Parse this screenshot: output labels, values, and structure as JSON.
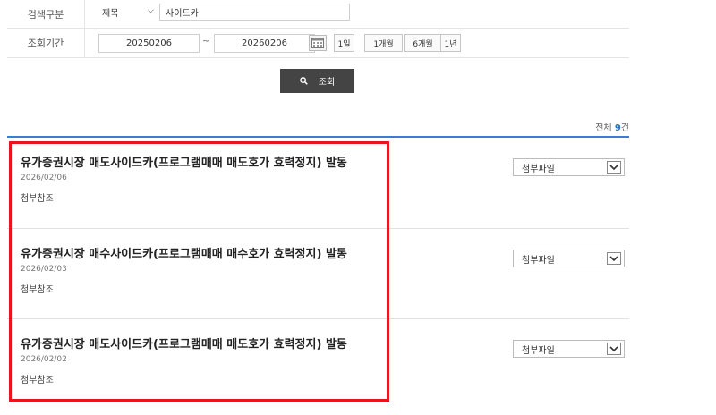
{
  "search_form": {
    "search_type_label": "검색구분",
    "search_field_selected": "제목",
    "search_keyword": "사이드카",
    "period_label": "조회기간",
    "date_from": "20250206",
    "date_separator": "~",
    "date_to": "20260206",
    "period_buttons": [
      "1일",
      "1개월",
      "6개월",
      "1년"
    ],
    "search_button_label": "조회"
  },
  "results": {
    "total_prefix": "전체 ",
    "total_count": "9",
    "total_suffix": "건",
    "items": [
      {
        "title": "유가증권시장 매도사이드카(프로그램매매 매도호가 효력정지) 발동",
        "date": "2026/02/06",
        "note": "첨부참조",
        "attachment_label": "첨부파일"
      },
      {
        "title": "유가증권시장 매수사이드카(프로그램매매 매수호가 효력정지) 발동",
        "date": "2026/02/03",
        "note": "첨부참조",
        "attachment_label": "첨부파일"
      },
      {
        "title": "유가증권시장 매도사이드카(프로그램매매 매도호가 효력정지) 발동",
        "date": "2026/02/02",
        "note": "첨부참조",
        "attachment_label": "첨부파일"
      }
    ]
  },
  "colors": {
    "accent_blue": "#3a7bd5",
    "highlight_red": "#e8151f",
    "search_button_bg": "#444444"
  },
  "icons": {
    "search_button": "search-icon",
    "calendar": "calendar-icon",
    "dropdown": "chevron-down-icon"
  }
}
